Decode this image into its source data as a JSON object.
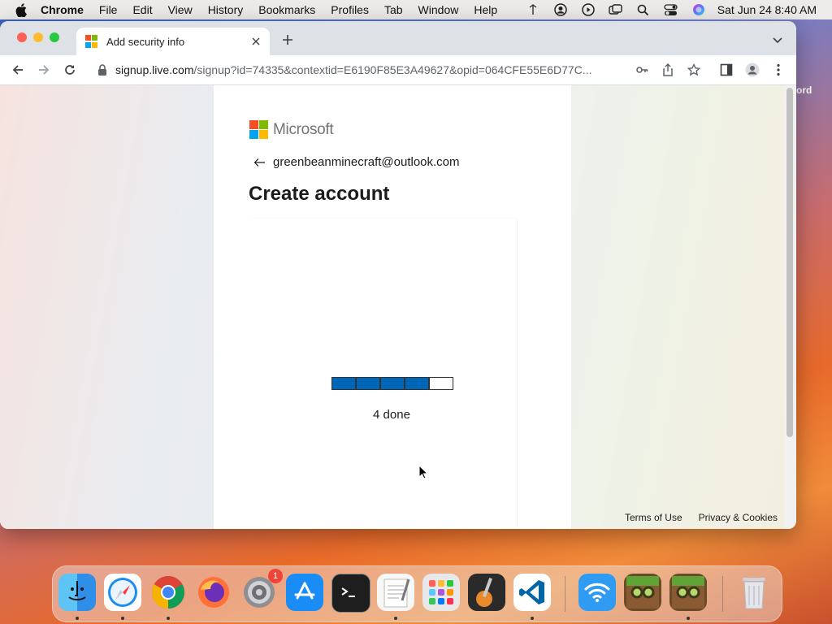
{
  "menubar": {
    "app": "Chrome",
    "menus": [
      "File",
      "Edit",
      "View",
      "History",
      "Bookmarks",
      "Profiles",
      "Tab",
      "Window",
      "Help"
    ],
    "clock": "Sat Jun 24  8:40 AM"
  },
  "desktop": {
    "peek_text": "ord"
  },
  "browser": {
    "tab_title": "Add security info",
    "url_host": "signup.live.com",
    "url_path": "/signup?id=74335&contextid=E6190F85E3A49627&opid=064CFE55E6D77C..."
  },
  "page": {
    "brand": "Microsoft",
    "email": "greenbeanminecraft@outlook.com",
    "heading": "Create account",
    "progress": {
      "completed": 4,
      "total": 5,
      "label": "4 done",
      "done_color": "#0067b8"
    },
    "footer": {
      "terms": "Terms of Use",
      "privacy": "Privacy & Cookies"
    }
  },
  "dock": {
    "apps": [
      "Finder",
      "Safari",
      "Chrome",
      "Firefox",
      "System Settings",
      "App Store",
      "Terminal",
      "TextEdit",
      "Launchpad",
      "GarageBand",
      "Visual Studio Code",
      "Wi-Fi Utility",
      "Minecraft",
      "Minecraft",
      "Trash"
    ],
    "settings_badge": "1"
  }
}
